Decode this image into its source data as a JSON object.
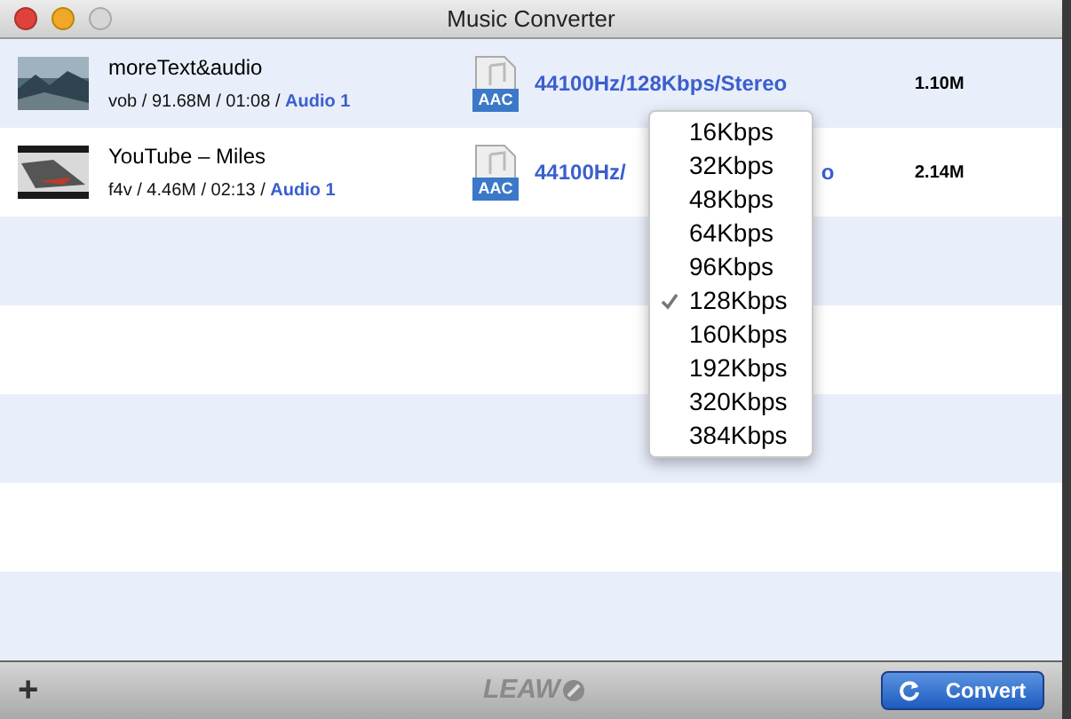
{
  "window": {
    "title": "Music Converter"
  },
  "files": [
    {
      "name": "moreText&audio",
      "details": "vob / 91.68M / 01:08 / ",
      "audio": "Audio 1",
      "format_icon": "AAC",
      "format": "44100Hz/128Kbps/Stereo",
      "size": "1.10M"
    },
    {
      "name": "YouTube – Miles",
      "details": "f4v / 4.46M / 02:13 / ",
      "audio": "Audio 1",
      "format_icon": "AAC",
      "format": "44100Hz/",
      "format_tail": "o",
      "size": "2.14M"
    }
  ],
  "bitrate_menu": [
    {
      "label": "16Kbps",
      "selected": false
    },
    {
      "label": "32Kbps",
      "selected": false
    },
    {
      "label": "48Kbps",
      "selected": false
    },
    {
      "label": "64Kbps",
      "selected": false
    },
    {
      "label": "96Kbps",
      "selected": false
    },
    {
      "label": "128Kbps",
      "selected": true
    },
    {
      "label": "160Kbps",
      "selected": false
    },
    {
      "label": "192Kbps",
      "selected": false
    },
    {
      "label": "320Kbps",
      "selected": false
    },
    {
      "label": "384Kbps",
      "selected": false
    }
  ],
  "bottom_bar": {
    "add": "+",
    "logo": "LEAW",
    "convert": "Convert"
  }
}
